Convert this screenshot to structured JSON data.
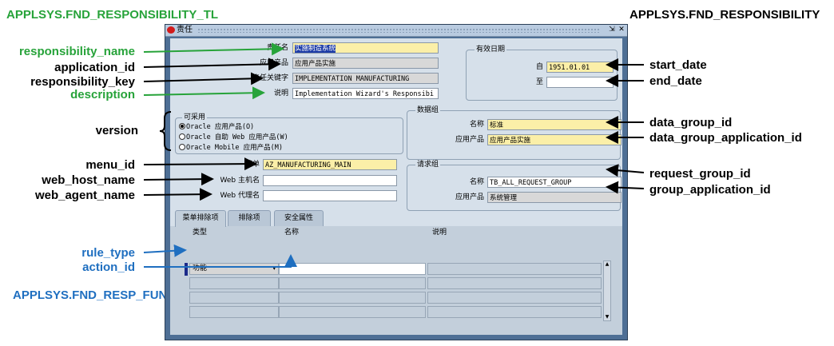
{
  "annotations": {
    "top_left_table": "APPLSYS.FND_RESPONSIBILITY_TL",
    "top_right_table": "APPLSYS.FND_RESPONSIBILITY",
    "responsibility_name": "responsibility_name",
    "application_id": "application_id",
    "responsibility_key": "responsibility_key",
    "description": "description",
    "version": "version",
    "menu_id": "menu_id",
    "web_host_name": "web_host_name",
    "web_agent_name": "web_agent_name",
    "rule_type": "rule_type",
    "action_id": "action_id",
    "bottom_table": "APPLSYS.FND_RESP_FUNCTIONS",
    "start_date": "start_date",
    "end_date": "end_date",
    "data_group_id": "data_group_id",
    "data_group_application_id": "data_group_application_id",
    "request_group_id": "request_group_id",
    "group_application_id": "group_application_id"
  },
  "window": {
    "title": "责任",
    "close": "✕",
    "restore": "⇲"
  },
  "form": {
    "name_label": "责任名",
    "name_value": "实施制造系统",
    "app_label": "应用产品",
    "app_value": "应用产品实施",
    "key_label": "责任关键字",
    "key_value": "IMPLEMENTATION MANUFACTURING",
    "desc_label": "说明",
    "desc_value": "Implementation Wizard's Responsibi",
    "effective_title": "有效日期",
    "from_label": "自",
    "from_value": "1951.01.01",
    "to_label": "至",
    "to_value": "",
    "available_title": "可采用",
    "radio_oracle": "Oracle 应用产品(O)",
    "radio_web": "Oracle 自助 Web 应用产品(W)",
    "radio_mobile": "Oracle Mobile 应用产品(M)",
    "data_group_title": "数据组",
    "dg_name_label": "名称",
    "dg_name_value": "标准",
    "dg_app_label": "应用产品",
    "dg_app_value": "应用产品实施",
    "menu_label": "菜单",
    "menu_value": "AZ_MANUFACTURING_MAIN",
    "web_host_label": "Web 主机名",
    "web_agent_label": "Web 代理名",
    "request_group_title": "请求组",
    "rg_name_label": "名称",
    "rg_name_value": "TB_ALL_REQUEST_GROUP",
    "rg_app_label": "应用产品",
    "rg_app_value": "系统管理"
  },
  "tabs": [
    {
      "label": "菜单排除项"
    },
    {
      "label": "排除项"
    },
    {
      "label": "安全属性"
    }
  ],
  "grid": {
    "col_type": "类型",
    "col_name": "名称",
    "col_desc": "说明",
    "row1_type": "功能"
  }
}
